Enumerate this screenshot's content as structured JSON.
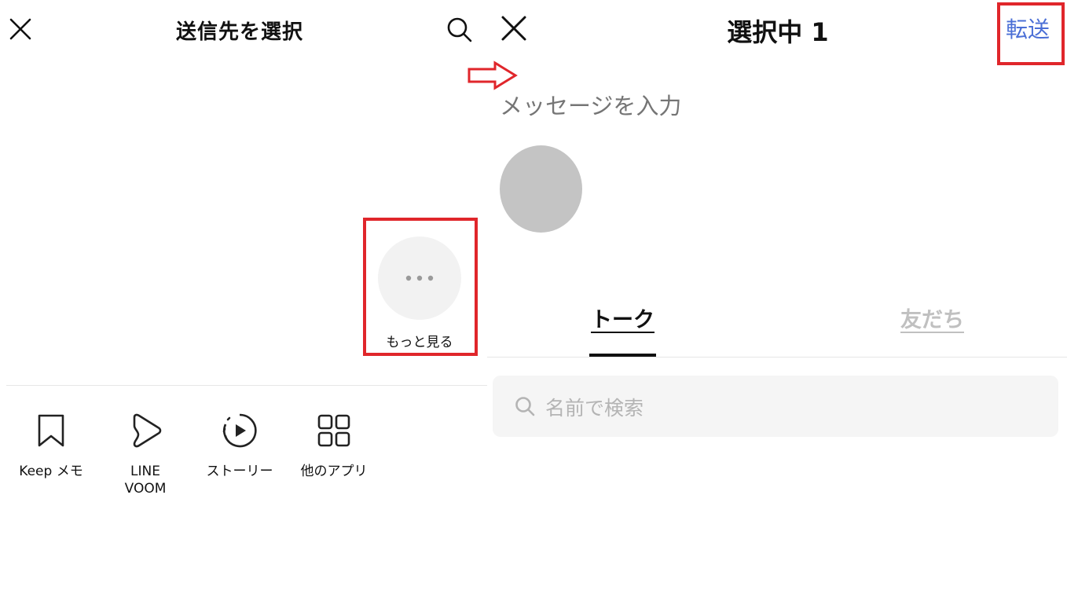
{
  "left_screen": {
    "title": "送信先を選択",
    "more": {
      "label": "もっと見る"
    },
    "share_targets": [
      {
        "label": "Keep メモ",
        "icon": "bookmark-icon"
      },
      {
        "label": "LINE\nVOOM",
        "icon": "voom-play-icon"
      },
      {
        "label": "ストーリー",
        "icon": "story-play-icon"
      },
      {
        "label": "他のアプリ",
        "icon": "grid-apps-icon"
      }
    ]
  },
  "right_screen": {
    "title": "選択中 1",
    "forward_label": "転送",
    "message_placeholder": "メッセージを入力",
    "tabs": [
      {
        "label": "トーク",
        "active": true
      },
      {
        "label": "友だち",
        "active": false
      }
    ],
    "search_placeholder": "名前で検索"
  },
  "colors": {
    "highlight": "#e0262b",
    "accent": "#4b6fd6"
  }
}
